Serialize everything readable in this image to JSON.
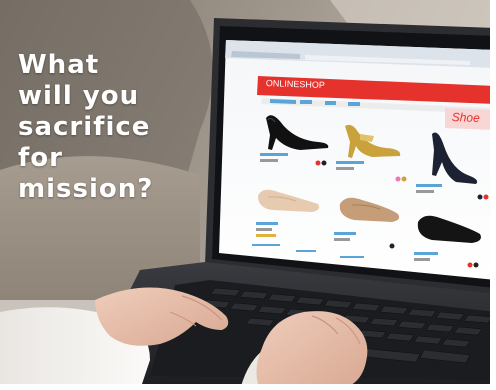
{
  "overlay": {
    "lines": [
      "What",
      "will you",
      "sacrifice",
      "for",
      "mission?"
    ]
  },
  "screen": {
    "shop_title": "ONLINESHOP",
    "banner_text": "Shoe"
  },
  "colors": {
    "background_warm": "#8a7f72",
    "sofa": "#9b9187",
    "laptop_body": "#2c2d31",
    "keyboard": "#1b1c1f",
    "shop_red": "#e5322c",
    "skin": "#e9c4b0",
    "sleeve": "#f3f0ed",
    "overlay_text": "#ffffff"
  },
  "products": [
    {
      "name": "black-pump-shoe",
      "color": "#111111"
    },
    {
      "name": "gold-heel-sandal",
      "color": "#c9a23c"
    },
    {
      "name": "navy-heel-shoe",
      "color": "#1d2233"
    },
    {
      "name": "beige-flat-shoe",
      "color": "#e7cbb0"
    },
    {
      "name": "tan-flat-shoe",
      "color": "#c59d79"
    },
    {
      "name": "black-flat-shoe",
      "color": "#141414"
    }
  ]
}
